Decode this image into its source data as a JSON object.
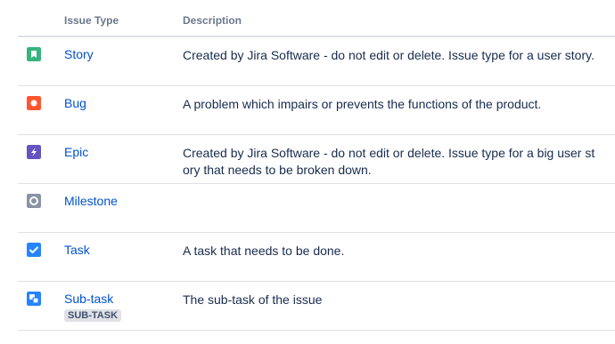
{
  "table": {
    "headers": {
      "issue_type": "Issue Type",
      "description": "Description"
    },
    "rows": [
      {
        "name": "Story",
        "description": "Created by Jira Software - do not edit or delete. Issue type for a user story.",
        "icon": "story-icon",
        "icon_color": "#36b37e"
      },
      {
        "name": "Bug",
        "description": "A problem which impairs or prevents the functions of the product.",
        "icon": "bug-icon",
        "icon_color": "#ff5630"
      },
      {
        "name": "Epic",
        "description": "Created by Jira Software - do not edit or delete. Issue type for a big user story that needs to be broken down.",
        "icon": "epic-icon",
        "icon_color": "#6554c0"
      },
      {
        "name": "Milestone",
        "description": "",
        "icon": "milestone-icon",
        "icon_color": "#8993a4"
      },
      {
        "name": "Task",
        "description": "A task that needs to be done.",
        "icon": "task-icon",
        "icon_color": "#2684ff"
      },
      {
        "name": "Sub-task",
        "description": "The sub-task of the issue",
        "icon": "subtask-icon",
        "icon_color": "#2684ff",
        "badge": "SUB-TASK"
      }
    ]
  }
}
